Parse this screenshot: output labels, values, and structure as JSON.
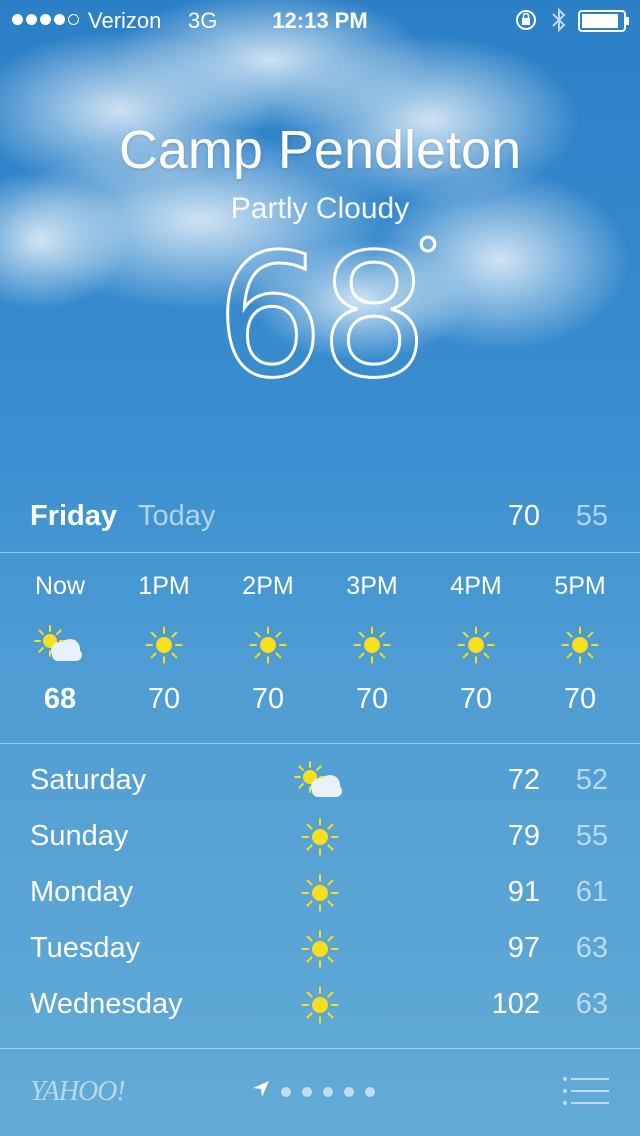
{
  "status_bar": {
    "carrier": "Verizon",
    "network": "3G",
    "time": "12:13 PM",
    "signal_bars": 4,
    "signal_max": 5,
    "icons": [
      "orientation-lock-icon",
      "bluetooth-icon",
      "battery-icon"
    ],
    "battery_level": 0.9
  },
  "location": {
    "city": "Camp Pendleton",
    "condition": "Partly Cloudy",
    "temperature": "68",
    "degree_symbol": "°"
  },
  "today": {
    "day": "Friday",
    "label": "Today",
    "high": "70",
    "low": "55"
  },
  "hourly": [
    {
      "time": "Now",
      "icon": "partly-cloudy-icon",
      "temp": "68"
    },
    {
      "time": "1PM",
      "icon": "sun-icon",
      "temp": "70"
    },
    {
      "time": "2PM",
      "icon": "sun-icon",
      "temp": "70"
    },
    {
      "time": "3PM",
      "icon": "sun-icon",
      "temp": "70"
    },
    {
      "time": "4PM",
      "icon": "sun-icon",
      "temp": "70"
    },
    {
      "time": "5PM",
      "icon": "sun-icon",
      "temp": "70"
    }
  ],
  "daily": [
    {
      "day": "Saturday",
      "icon": "partly-cloudy-icon",
      "high": "72",
      "low": "52"
    },
    {
      "day": "Sunday",
      "icon": "sun-icon",
      "high": "79",
      "low": "55"
    },
    {
      "day": "Monday",
      "icon": "sun-icon",
      "high": "91",
      "low": "61"
    },
    {
      "day": "Tuesday",
      "icon": "sun-icon",
      "high": "97",
      "low": "63"
    },
    {
      "day": "Wednesday",
      "icon": "sun-icon",
      "high": "102",
      "low": "63"
    }
  ],
  "footer": {
    "brand": "YAHOO!",
    "page_count": 6,
    "current_page": "location-arrow-icon",
    "menu_icon": "list-icon"
  },
  "colors": {
    "sky_top": "#2b7fc6",
    "sky_bottom": "#63abd6",
    "sun": "#f7df1e",
    "text": "#ffffff"
  }
}
